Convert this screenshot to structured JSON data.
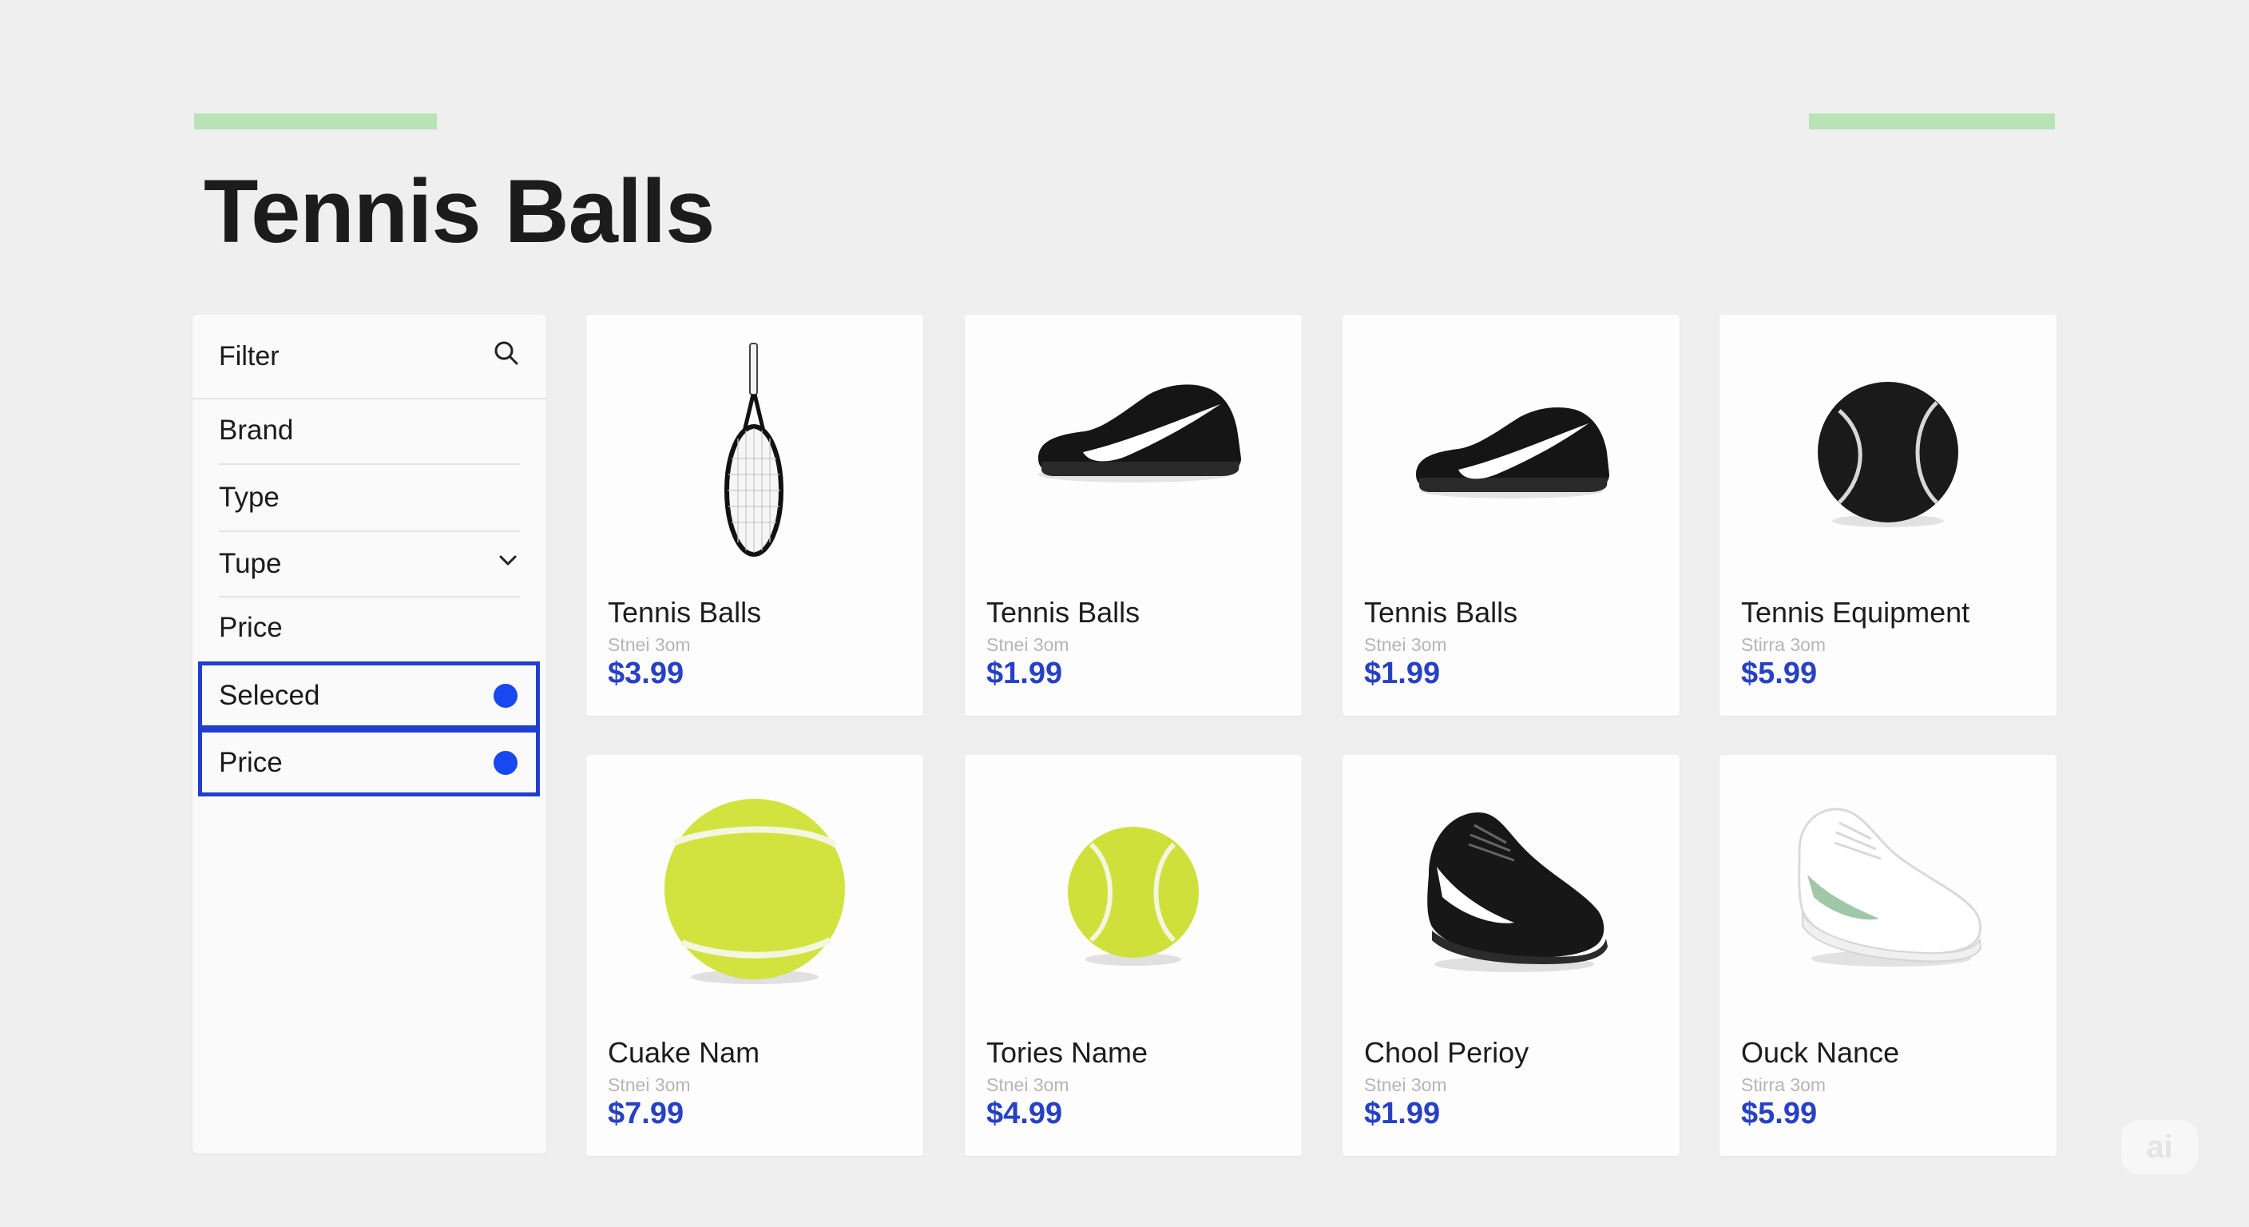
{
  "page": {
    "title": "Tennis Balls",
    "accent_color": "#b7e3b5",
    "price_color": "#2741c4",
    "selection_color": "#1f3fd0"
  },
  "sidebar": {
    "filter_label": "Filter",
    "search_icon": "search-icon",
    "items": [
      {
        "label": "Brand"
      },
      {
        "label": "Type"
      },
      {
        "label": "Tupe",
        "icon": "chevron-down-icon"
      },
      {
        "label": "Price"
      }
    ],
    "selected": [
      {
        "label": "Seleced",
        "icon": "blue-dot"
      },
      {
        "label": "Price",
        "icon": "blue-dot"
      }
    ]
  },
  "products": [
    {
      "name": "Tennis Balls",
      "sub": "Stnei 3om",
      "price": "$3.99",
      "image": "tennis-racket"
    },
    {
      "name": "Tennis Balls",
      "sub": "Stnei 3om",
      "price": "$1.99",
      "image": "black-sneaker"
    },
    {
      "name": "Tennis Balls",
      "sub": "Stnei 3om",
      "price": "$1.99",
      "image": "black-sneaker"
    },
    {
      "name": "Tennis Equipment",
      "sub": "Stirra 3om",
      "price": "$5.99",
      "image": "black-ball"
    },
    {
      "name": "Cuake Nam",
      "sub": "Stnei 3om",
      "price": "$7.99",
      "image": "tennis-ball"
    },
    {
      "name": "Tories Name",
      "sub": "Stnei 3om",
      "price": "$4.99",
      "image": "tennis-ball"
    },
    {
      "name": "Chool Perioy",
      "sub": "Stnei 3om",
      "price": "$1.99",
      "image": "black-high-sneaker"
    },
    {
      "name": "Ouck Nance",
      "sub": "Stirra 3om",
      "price": "$5.99",
      "image": "white-sneaker"
    }
  ],
  "badge": {
    "label": "ai"
  }
}
